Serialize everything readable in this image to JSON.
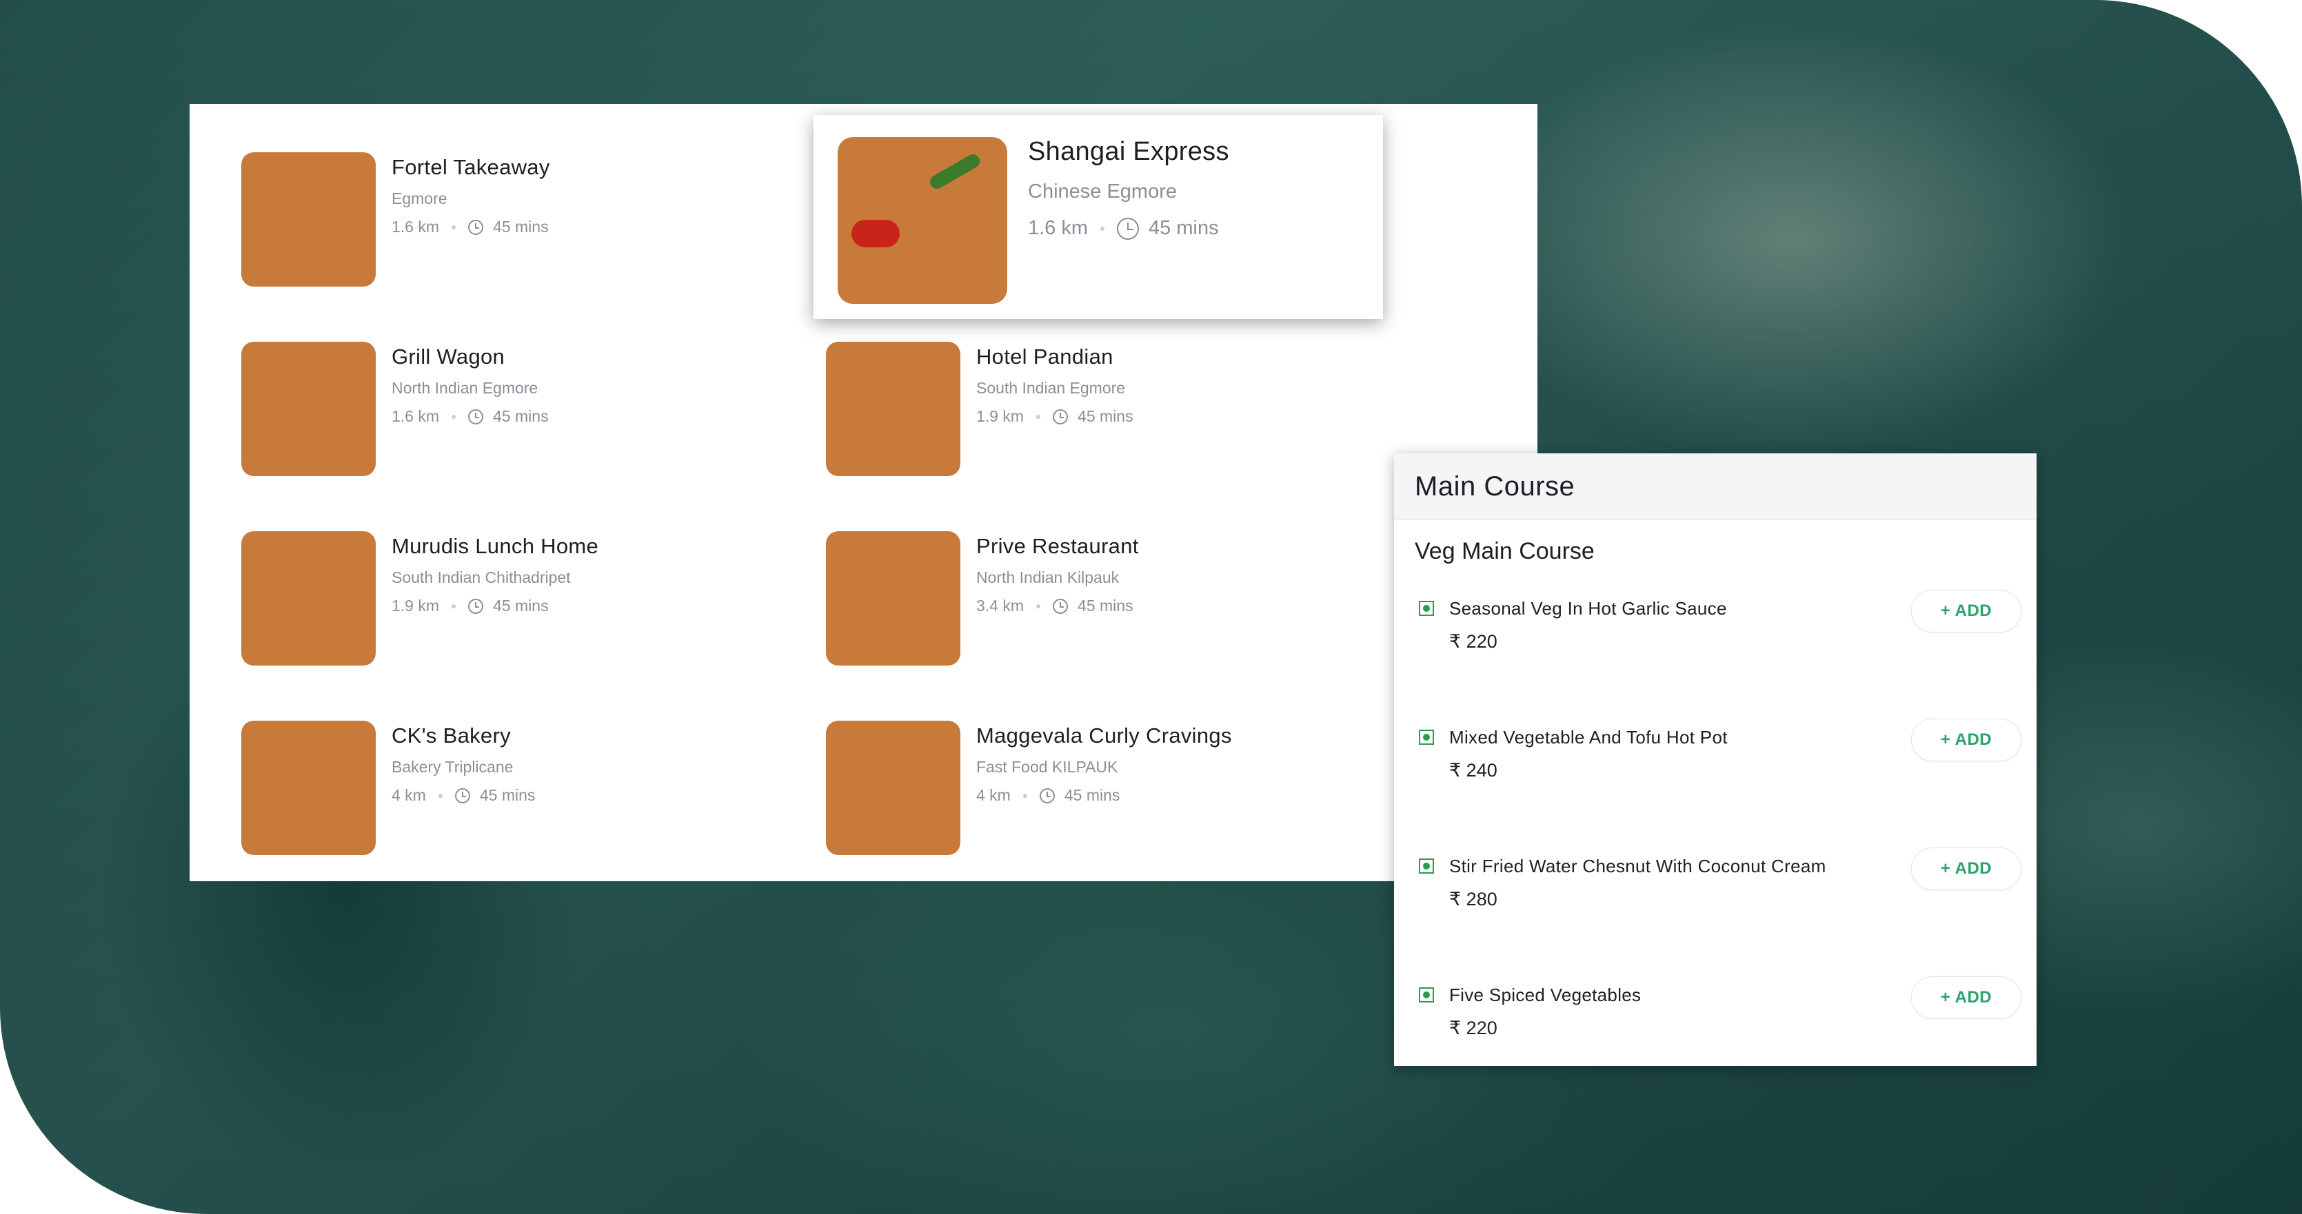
{
  "restaurants": [
    {
      "name": "Fortel Takeaway",
      "cuisine": "Egmore",
      "distance": "1.6 km",
      "time": "45 mins"
    },
    {
      "name": "Grill Wagon",
      "cuisine": "North Indian  Egmore",
      "distance": "1.6 km",
      "time": "45 mins"
    },
    {
      "name": "Hotel Pandian",
      "cuisine": "South Indian  Egmore",
      "distance": "1.9 km",
      "time": "45 mins"
    },
    {
      "name": "Murudis Lunch Home",
      "cuisine": "South Indian  Chithadripet",
      "distance": "1.9 km",
      "time": "45 mins"
    },
    {
      "name": "Prive Restaurant",
      "cuisine": "North Indian  Kilpauk",
      "distance": "3.4 km",
      "time": "45 mins"
    },
    {
      "name": "CK's Bakery",
      "cuisine": "Bakery  Triplicane",
      "distance": "4 km",
      "time": "45 mins"
    },
    {
      "name": "Maggevala Curly Cravings",
      "cuisine": "Fast Food  KILPAUK",
      "distance": "4 km",
      "time": "45 mins"
    }
  ],
  "highlight": {
    "name": "Shangai Express",
    "cuisine": "Chinese  Egmore",
    "distance": "1.6 km",
    "time": "45 mins"
  },
  "menu": {
    "title": "Main Course",
    "section": "Veg Main Course",
    "add_label": "+ ADD",
    "dishes": [
      {
        "name": "Seasonal Veg In Hot Garlic Sauce",
        "price": "₹ 220"
      },
      {
        "name": "Mixed Vegetable And Tofu Hot Pot",
        "price": "₹ 240"
      },
      {
        "name": "Stir Fried Water Chesnut With Coconut Cream",
        "price": "₹ 280"
      },
      {
        "name": "Five Spiced Vegetables",
        "price": "₹ 220"
      }
    ]
  },
  "colors": {
    "accent": "#2aa36a",
    "veg": "#2a9d4a",
    "text": "#1d1f24",
    "muted": "#8a8f98"
  }
}
